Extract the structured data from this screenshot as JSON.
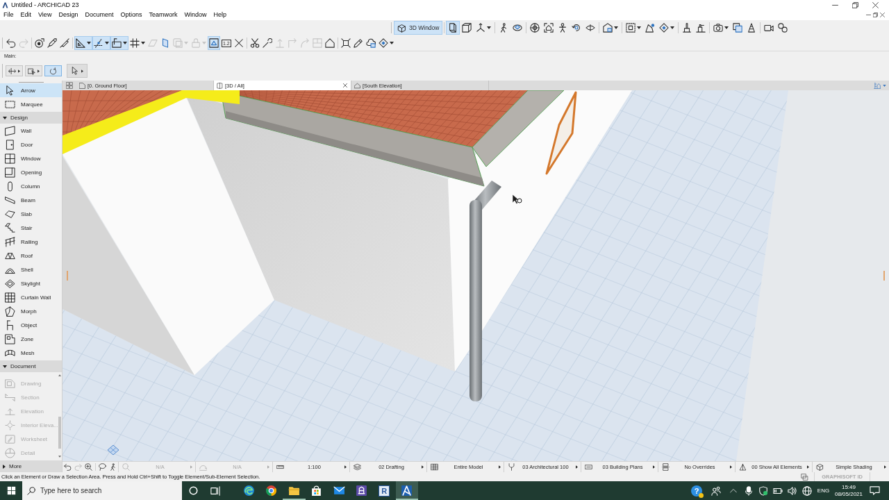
{
  "window": {
    "title": "Untitled - ARCHICAD 23"
  },
  "menu": [
    "File",
    "Edit",
    "View",
    "Design",
    "Document",
    "Options",
    "Teamwork",
    "Window",
    "Help"
  ],
  "view_toolbar": {
    "button": {
      "label": "3D Window",
      "selected": true
    },
    "groups": [
      {
        "tools": [
          {
            "selected": true,
            "disabled": false,
            "dropdown": false
          },
          {
            "selected": false,
            "disabled": false,
            "dropdown": false
          },
          {
            "selected": false,
            "disabled": false,
            "dropdown": true
          }
        ]
      },
      {
        "tools": [
          {
            "selected": false,
            "disabled": false,
            "dropdown": false
          },
          {
            "selected": false,
            "disabled": false,
            "dropdown": false
          }
        ]
      },
      {
        "tools": [
          {
            "selected": false,
            "disabled": false,
            "dropdown": false
          },
          {
            "selected": false,
            "disabled": false,
            "dropdown": false
          },
          {
            "selected": false,
            "disabled": false,
            "dropdown": false
          },
          {
            "selected": false,
            "disabled": false,
            "dropdown": false
          },
          {
            "selected": false,
            "disabled": false,
            "dropdown": false
          }
        ]
      },
      {
        "tools": [
          {
            "selected": false,
            "disabled": false,
            "dropdown": true
          }
        ]
      },
      {
        "tools": [
          {
            "selected": false,
            "disabled": false,
            "dropdown": true
          },
          {
            "selected": false,
            "disabled": false,
            "dropdown": false
          },
          {
            "selected": false,
            "disabled": false,
            "dropdown": true
          }
        ]
      },
      {
        "tools": [
          {
            "selected": false,
            "disabled": false,
            "dropdown": false
          },
          {
            "selected": false,
            "disabled": false,
            "dropdown": false
          }
        ]
      },
      {
        "tools": [
          {
            "selected": false,
            "disabled": false,
            "dropdown": true
          },
          {
            "selected": false,
            "disabled": false,
            "dropdown": false
          },
          {
            "selected": false,
            "disabled": false,
            "dropdown": false
          }
        ]
      },
      {
        "tools": [
          {
            "selected": false,
            "disabled": false,
            "dropdown": false
          },
          {
            "selected": false,
            "disabled": false,
            "dropdown": false
          }
        ]
      }
    ]
  },
  "standard_toolbar": {
    "groups": [
      {
        "tools": [
          {
            "selected": false,
            "disabled": false,
            "dropdown": false
          },
          {
            "selected": false,
            "disabled": true,
            "dropdown": false
          }
        ]
      },
      {
        "tools": [
          {
            "selected": false,
            "disabled": false,
            "dropdown": false
          },
          {
            "selected": false,
            "disabled": false,
            "dropdown": false
          },
          {
            "selected": false,
            "disabled": false,
            "dropdown": false
          }
        ]
      },
      {
        "tools": [
          {
            "selected": true,
            "disabled": false,
            "dropdown": true
          },
          {
            "selected": true,
            "disabled": false,
            "dropdown": true
          },
          {
            "selected": true,
            "disabled": false,
            "dropdown": true
          },
          {
            "selected": false,
            "disabled": false,
            "dropdown": true
          },
          {
            "selected": false,
            "disabled": true,
            "dropdown": false
          },
          {
            "selected": false,
            "disabled": false,
            "dropdown": false
          },
          {
            "selected": false,
            "disabled": true,
            "dropdown": true
          },
          {
            "selected": false,
            "disabled": true,
            "dropdown": true
          },
          {
            "selected": true,
            "disabled": false,
            "dropdown": false
          },
          {
            "text": "1.2",
            "selected": false,
            "disabled": false,
            "dropdown": false
          },
          {
            "selected": false,
            "disabled": false,
            "dropdown": false
          }
        ]
      },
      {
        "tools": [
          {
            "selected": false,
            "disabled": false,
            "dropdown": false
          },
          {
            "selected": false,
            "disabled": false,
            "dropdown": false
          },
          {
            "selected": false,
            "disabled": true,
            "dropdown": false
          },
          {
            "selected": false,
            "disabled": true,
            "dropdown": false
          },
          {
            "selected": false,
            "disabled": true,
            "dropdown": false
          },
          {
            "selected": false,
            "disabled": true,
            "dropdown": false
          },
          {
            "selected": false,
            "disabled": false,
            "dropdown": false
          }
        ]
      },
      {
        "tools": [
          {
            "selected": false,
            "disabled": false,
            "dropdown": false
          },
          {
            "selected": false,
            "disabled": false,
            "dropdown": false
          },
          {
            "selected": false,
            "disabled": false,
            "dropdown": false
          },
          {
            "selected": false,
            "disabled": false,
            "dropdown": true
          }
        ]
      }
    ]
  },
  "infobox": {
    "title": "Main:",
    "buttons": [
      {
        "kind": "small",
        "selected": false,
        "dropdown": true
      },
      {
        "kind": "small",
        "selected": false,
        "dropdown": true
      },
      {
        "kind": "small",
        "selected": true,
        "dropdown": false
      },
      {
        "kind": "large",
        "selected": false,
        "dropdown": true
      }
    ]
  },
  "toolbox": {
    "tools": [
      {
        "label": "Arrow",
        "selected": true,
        "disabled": false
      },
      {
        "label": "Marquee",
        "selected": false,
        "disabled": false
      }
    ],
    "palettes": [
      {
        "label": "Design",
        "expanded": true,
        "tools": [
          {
            "label": "Wall",
            "selected": false,
            "disabled": false
          },
          {
            "label": "Door",
            "selected": false,
            "disabled": false
          },
          {
            "label": "Window",
            "selected": false,
            "disabled": false
          },
          {
            "label": "Opening",
            "selected": false,
            "disabled": false
          },
          {
            "label": "Column",
            "selected": false,
            "disabled": false
          },
          {
            "label": "Beam",
            "selected": false,
            "disabled": false
          },
          {
            "label": "Slab",
            "selected": false,
            "disabled": false
          },
          {
            "label": "Stair",
            "selected": false,
            "disabled": false
          },
          {
            "label": "Railing",
            "selected": false,
            "disabled": false
          },
          {
            "label": "Roof",
            "selected": false,
            "disabled": false
          },
          {
            "label": "Shell",
            "selected": false,
            "disabled": false
          },
          {
            "label": "Skylight",
            "selected": false,
            "disabled": false
          },
          {
            "label": "Curtain Wall",
            "selected": false,
            "disabled": false
          },
          {
            "label": "Morph",
            "selected": false,
            "disabled": false
          },
          {
            "label": "Object",
            "selected": false,
            "disabled": false
          },
          {
            "label": "Zone",
            "selected": false,
            "disabled": false
          },
          {
            "label": "Mesh",
            "selected": false,
            "disabled": false
          }
        ]
      },
      {
        "label": "Document",
        "expanded": true,
        "tools": [
          {
            "label": "Drawing",
            "selected": false,
            "disabled": true
          },
          {
            "label": "Section",
            "selected": false,
            "disabled": true
          },
          {
            "label": "Elevation",
            "selected": false,
            "disabled": true
          },
          {
            "label": "Interior Eleva...",
            "selected": false,
            "disabled": true
          },
          {
            "label": "Worksheet",
            "selected": false,
            "disabled": true
          },
          {
            "label": "Detail",
            "selected": false,
            "disabled": true
          }
        ]
      },
      {
        "label": "More",
        "expanded": false
      }
    ]
  },
  "view_tabs": [
    {
      "label": "[0. Ground Floor]",
      "selected": false
    },
    {
      "label": "[3D / All]",
      "selected": true
    },
    {
      "label": "[South Elevation]",
      "selected": false
    }
  ],
  "navigation": [
    {
      "disabled": false
    },
    {
      "disabled": true
    },
    {
      "disabled": false
    },
    {
      "disabled": false
    },
    {
      "disabled": false
    }
  ],
  "quick_options": [
    {
      "value": "N/A",
      "disabled": true
    },
    {
      "value": "N/A",
      "disabled": true
    },
    {
      "value": "1:100",
      "disabled": false
    },
    {
      "value": "02 Drafting",
      "disabled": false
    },
    {
      "value": "Entire Model",
      "disabled": false
    },
    {
      "value": "03 Architectural 100",
      "disabled": false
    },
    {
      "value": "03 Building Plans",
      "disabled": false
    },
    {
      "value": "No Overrides",
      "disabled": false
    },
    {
      "value": "00 Show All Elements",
      "disabled": false
    },
    {
      "value": "Simple Shading",
      "disabled": false
    }
  ],
  "status_bar": {
    "message": "Click an Element or Draw a Selection Area. Press and Hold Ctrl+Shift to Toggle Element/Sub-Element Selection.",
    "account": "GRAPHISOFT ID"
  },
  "taskbar": {
    "search": {
      "placeholder": "Type here to search"
    },
    "apps": [
      {
        "running": false,
        "active": false
      },
      {
        "running": false,
        "active": false
      },
      {
        "running": true,
        "active": false
      },
      {
        "running": false,
        "active": false
      },
      {
        "running": false,
        "active": false
      },
      {
        "running": false,
        "active": false
      },
      {
        "letter": "R",
        "running": false,
        "active": false
      },
      {
        "running": true,
        "active": true
      }
    ],
    "tray": {
      "help": "?",
      "language": "ENG",
      "time": "15:49",
      "date": "08/05/2021"
    }
  }
}
